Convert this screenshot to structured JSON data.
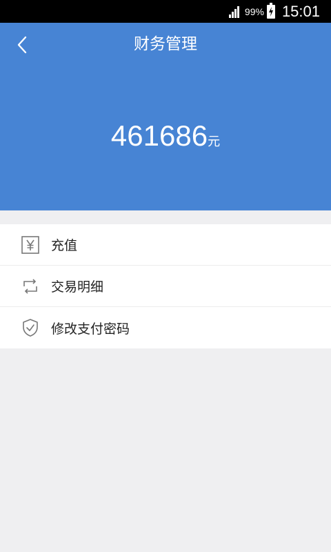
{
  "status_bar": {
    "battery_percent": "99%",
    "time": "15:01",
    "signal_icon": "signal-icon",
    "battery_icon": "battery-charging-icon"
  },
  "header": {
    "back_icon": "back-arrow-icon",
    "title": "财务管理",
    "balance_amount": "461686",
    "balance_unit": "元",
    "background_color": "#4784d4"
  },
  "menu": {
    "items": [
      {
        "label": "充值",
        "icon": "yen-icon"
      },
      {
        "label": "交易明细",
        "icon": "exchange-icon"
      },
      {
        "label": "修改支付密码",
        "icon": "shield-check-icon"
      }
    ]
  }
}
